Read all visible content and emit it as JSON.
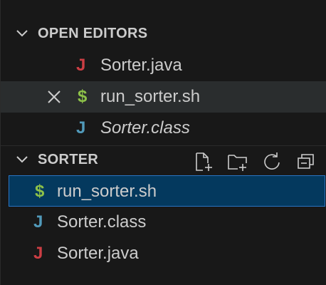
{
  "open_editors": {
    "title": "OPEN EDITORS",
    "items": [
      {
        "name": "Sorter.java",
        "icon_glyph": "J",
        "icon": "java-file-icon",
        "color": "#cc3e44"
      },
      {
        "name": "run_sorter.sh",
        "icon_glyph": "$",
        "icon": "shell-file-icon",
        "color": "#8dc149"
      },
      {
        "name": "Sorter.class",
        "icon_glyph": "J",
        "icon": "java-class-file-icon",
        "color": "#519aba"
      }
    ]
  },
  "folder": {
    "title": "SORTER",
    "toolbar_icons": [
      "new-file-icon",
      "new-folder-icon",
      "refresh-icon",
      "collapse-all-icon"
    ],
    "items": [
      {
        "name": "run_sorter.sh",
        "icon_glyph": "$",
        "icon": "shell-file-icon",
        "color": "#8dc149"
      },
      {
        "name": "Sorter.class",
        "icon_glyph": "J",
        "icon": "java-class-file-icon",
        "color": "#519aba"
      },
      {
        "name": "Sorter.java",
        "icon_glyph": "J",
        "icon": "java-file-icon",
        "color": "#cc3e44"
      }
    ]
  }
}
